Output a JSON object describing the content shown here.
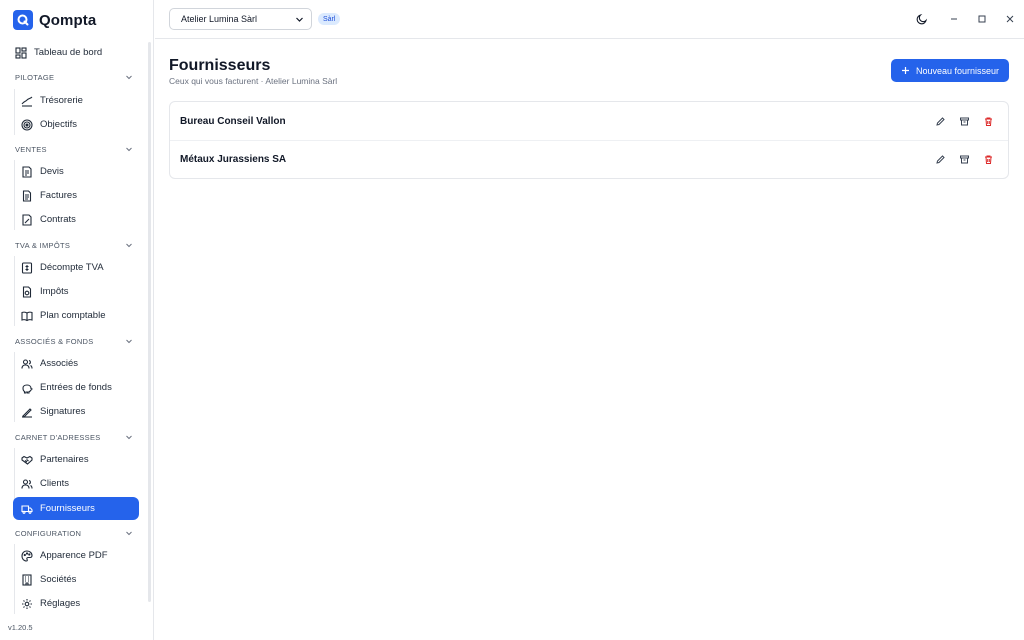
{
  "app": {
    "name": "Qompta",
    "version": "v1.20.5"
  },
  "header": {
    "company": "Atelier Lumina Sàrl",
    "company_badge": "Sàrl"
  },
  "sidebar": {
    "dashboard": "Tableau de bord",
    "sections": {
      "pilotage": "PILOTAGE",
      "ventes": "VENTES",
      "tva": "TVA & IMPÔTS",
      "associes": "ASSOCIÉS & FONDS",
      "carnet": "CARNET D'ADRESSES",
      "config": "CONFIGURATION"
    },
    "items": {
      "tresorerie": "Trésorerie",
      "objectifs": "Objectifs",
      "devis": "Devis",
      "factures": "Factures",
      "contrats": "Contrats",
      "decompte_tva": "Décompte TVA",
      "impots": "Impôts",
      "plan_comptable": "Plan comptable",
      "associes": "Associés",
      "entrees_fonds": "Entrées de fonds",
      "signatures": "Signatures",
      "partenaires": "Partenaires",
      "clients": "Clients",
      "fournisseurs": "Fournisseurs",
      "apparence_pdf": "Apparence PDF",
      "societes": "Sociétés",
      "reglages": "Réglages"
    }
  },
  "main": {
    "title": "Fournisseurs",
    "subtitle": "Ceux qui vous facturent · Atelier Lumina Sàrl",
    "new_button": "Nouveau fournisseur",
    "suppliers": [
      {
        "name": "Bureau Conseil Vallon"
      },
      {
        "name": "Métaux Jurassiens SA"
      }
    ]
  },
  "colors": {
    "accent": "#2563eb",
    "danger": "#dc2626"
  }
}
